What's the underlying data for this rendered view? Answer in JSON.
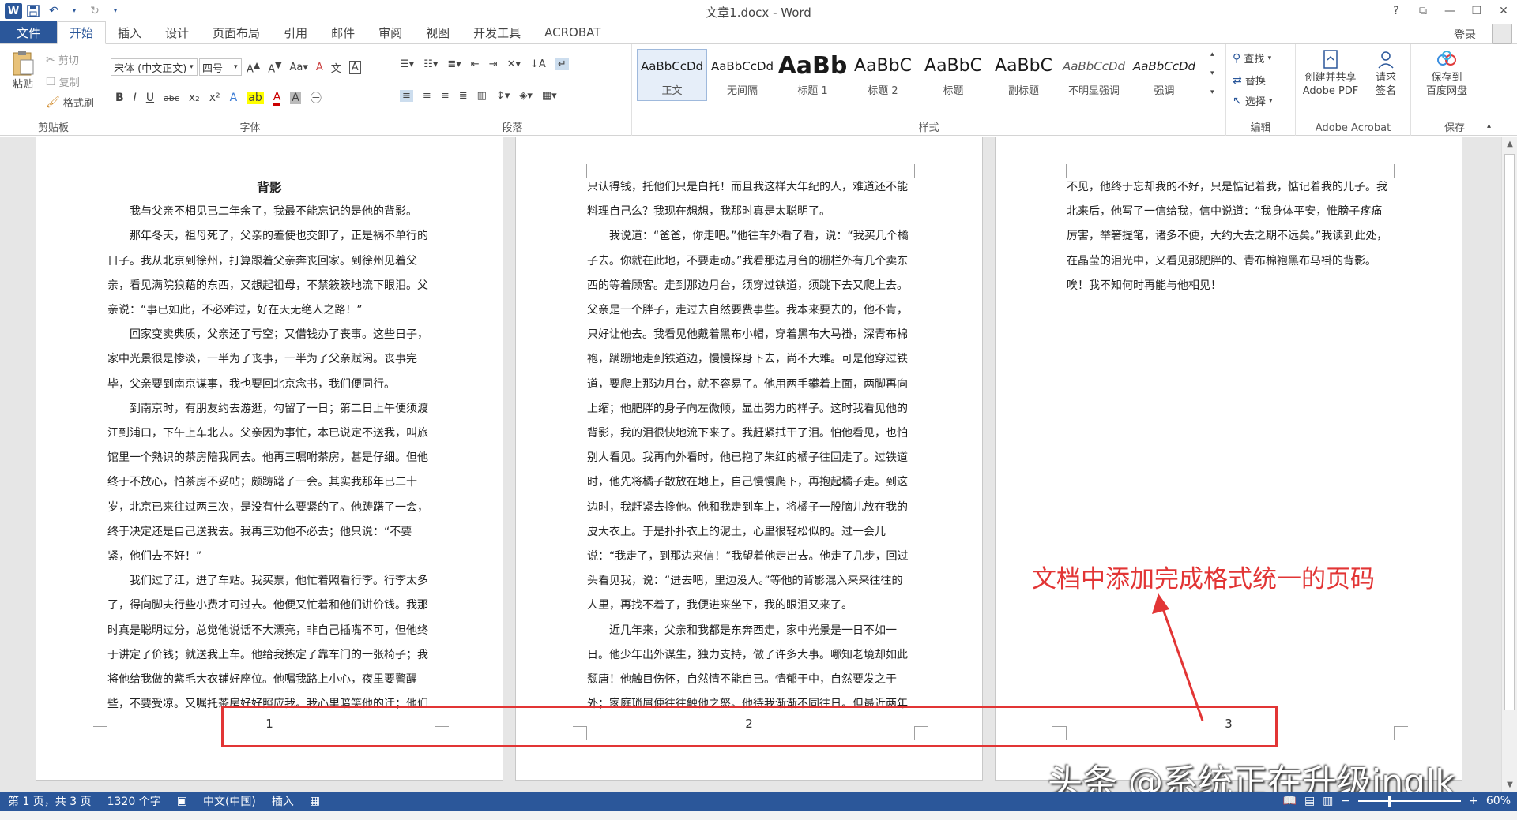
{
  "window": {
    "title": "文章1.docx - Word",
    "help": "?",
    "restore_ribbon": "⧉",
    "minimize": "—",
    "maximize": "❐",
    "close": "✕"
  },
  "qat": {
    "word_icon": "W",
    "save_icon": "save-icon",
    "undo_icon": "undo-icon",
    "redo_icon": "redo-icon"
  },
  "tabs": [
    {
      "label": "文件"
    },
    {
      "label": "开始"
    },
    {
      "label": "插入"
    },
    {
      "label": "设计"
    },
    {
      "label": "页面布局"
    },
    {
      "label": "引用"
    },
    {
      "label": "邮件"
    },
    {
      "label": "审阅"
    },
    {
      "label": "视图"
    },
    {
      "label": "开发工具"
    },
    {
      "label": "ACROBAT"
    }
  ],
  "login": "登录",
  "ribbon": {
    "clipboard": {
      "paste": "粘贴",
      "cut": "剪切",
      "copy": "复制",
      "format_painter": "格式刷",
      "label": "剪贴板"
    },
    "font": {
      "name": "宋体 (中文正文)",
      "size": "四号",
      "label": "字体"
    },
    "paragraph": {
      "label": "段落"
    },
    "styles": {
      "label": "样式",
      "items": [
        {
          "preview": "AaBbCcDd",
          "name": "正文"
        },
        {
          "preview": "AaBbCcDd",
          "name": "无间隔"
        },
        {
          "preview": "AaBb",
          "name": "标题 1"
        },
        {
          "preview": "AaBbC",
          "name": "标题 2"
        },
        {
          "preview": "AaBbC",
          "name": "标题"
        },
        {
          "preview": "AaBbC",
          "name": "副标题"
        },
        {
          "preview": "AaBbCcDd",
          "name": "不明显强调"
        },
        {
          "preview": "AaBbCcDd",
          "name": "强调"
        }
      ]
    },
    "editing": {
      "find": "查找",
      "replace": "替换",
      "select": "选择",
      "label": "编辑"
    },
    "acrobat": {
      "create_pdf_1": "创建并共享",
      "create_pdf_2": "Adobe PDF",
      "sign_1": "请求",
      "sign_2": "签名",
      "label": "Adobe Acrobat"
    },
    "save": {
      "baidu_1": "保存到",
      "baidu_2": "百度网盘",
      "label": "保存"
    }
  },
  "pages": [
    {
      "number": "1",
      "heading": "背影",
      "paragraphs": [
        "我与父亲不相见已二年余了，我最不能忘记的是他的背影。",
        "那年冬天，祖母死了，父亲的差使也交卸了，正是祸不单行的日子。我从北京到徐州，打算跟着父亲奔丧回家。到徐州见着父亲，看见满院狼藉的东西，又想起祖母，不禁簌簌地流下眼泪。父亲说：“事已如此，不必难过，好在天无绝人之路！”",
        "回家变卖典质，父亲还了亏空；又借钱办了丧事。这些日子，家中光景很是惨淡，一半为了丧事，一半为了父亲赋闲。丧事完毕，父亲要到南京谋事，我也要回北京念书，我们便同行。",
        "到南京时，有朋友约去游逛，勾留了一日；第二日上午便须渡江到浦口，下午上车北去。父亲因为事忙，本已说定不送我，叫旅馆里一个熟识的茶房陪我同去。他再三嘱咐茶房，甚是仔细。但他终于不放心，怕茶房不妥帖；颇踌躇了一会。其实我那年已二十岁，北京已来往过两三次，是没有什么要紧的了。他踌躇了一会，终于决定还是自己送我去。我再三劝他不必去；他只说：“不要紧，他们去不好！”",
        "我们过了江，进了车站。我买票，他忙着照看行李。行李太多了，得向脚夫行些小费才可过去。他便又忙着和他们讲价钱。我那时真是聪明过分，总觉他说话不大漂亮，非自己插嘴不可，但他终于讲定了价钱；就送我上车。他给我拣定了靠车门的一张椅子；我将他给我做的紫毛大衣铺好座位。他嘱我路上小心，夜里要警醒些，不要受凉。又嘱托茶房好好照应我。我心里暗笑他的迂；他们"
      ]
    },
    {
      "number": "2",
      "paragraphs": [
        "只认得钱，托他们只是白托！而且我这样大年纪的人，难道还不能料理自己么？我现在想想，我那时真是太聪明了。",
        "我说道：“爸爸，你走吧。”他往车外看了看，说：“我买几个橘子去。你就在此地，不要走动。”我看那边月台的栅栏外有几个卖东西的等着顾客。走到那边月台，须穿过铁道，须跳下去又爬上去。父亲是一个胖子，走过去自然要费事些。我本来要去的，他不肯，只好让他去。我看见他戴着黑布小帽，穿着黑布大马褂，深青布棉袍，蹒跚地走到铁道边，慢慢探身下去，尚不大难。可是他穿过铁道，要爬上那边月台，就不容易了。他用两手攀着上面，两脚再向上缩；他肥胖的身子向左微倾，显出努力的样子。这时我看见他的背影，我的泪很快地流下来了。我赶紧拭干了泪。怕他看见，也怕别人看见。我再向外看时，他已抱了朱红的橘子往回走了。过铁道时，他先将橘子散放在地上，自己慢慢爬下，再抱起橘子走。到这边时，我赶紧去搀他。他和我走到车上，将橘子一股脑儿放在我的皮大衣上。于是扑扑衣上的泥土，心里很轻松似的。过一会儿说：“我走了，到那边来信！”我望着他走出去。他走了几步，回过头看见我，说：“进去吧，里边没人。”等他的背影混入来来往往的人里，再找不着了，我便进来坐下，我的眼泪又来了。",
        "近几年来，父亲和我都是东奔西走，家中光景是一日不如一日。他少年出外谋生，独力支持，做了许多大事。哪知老境却如此颓唐！他触目伤怀，自然情不能自已。情郁于中，自然要发之于外；家庭琐屑便往往触他之怒。他待我渐渐不同往日。但最近两年"
      ]
    },
    {
      "number": "3",
      "paragraphs": [
        "不见，他终于忘却我的不好，只是惦记着我，惦记着我的儿子。我北来后，他写了一信给我，信中说道：“我身体平安，惟膀子疼痛厉害，举箸提笔，诸多不便，大约大去之期不远矣。”我读到此处，在晶莹的泪光中，又看见那肥胖的、青布棉袍黑布马褂的背影。唉！我不知何时再能与他相见！"
      ]
    }
  ],
  "annotation": {
    "text": "文档中添加完成格式统一的页码",
    "color": "#e23535"
  },
  "watermark": "头条 @系统正在升级inglk",
  "status": {
    "page": "第 1 页，共 3 页",
    "words": "1320 个字",
    "language": "中文(中国)",
    "mode": "插入",
    "zoom": "60%",
    "zoom_fraction": 0.3
  },
  "colors": {
    "accent": "#2b579a",
    "annotation": "#e23535"
  }
}
